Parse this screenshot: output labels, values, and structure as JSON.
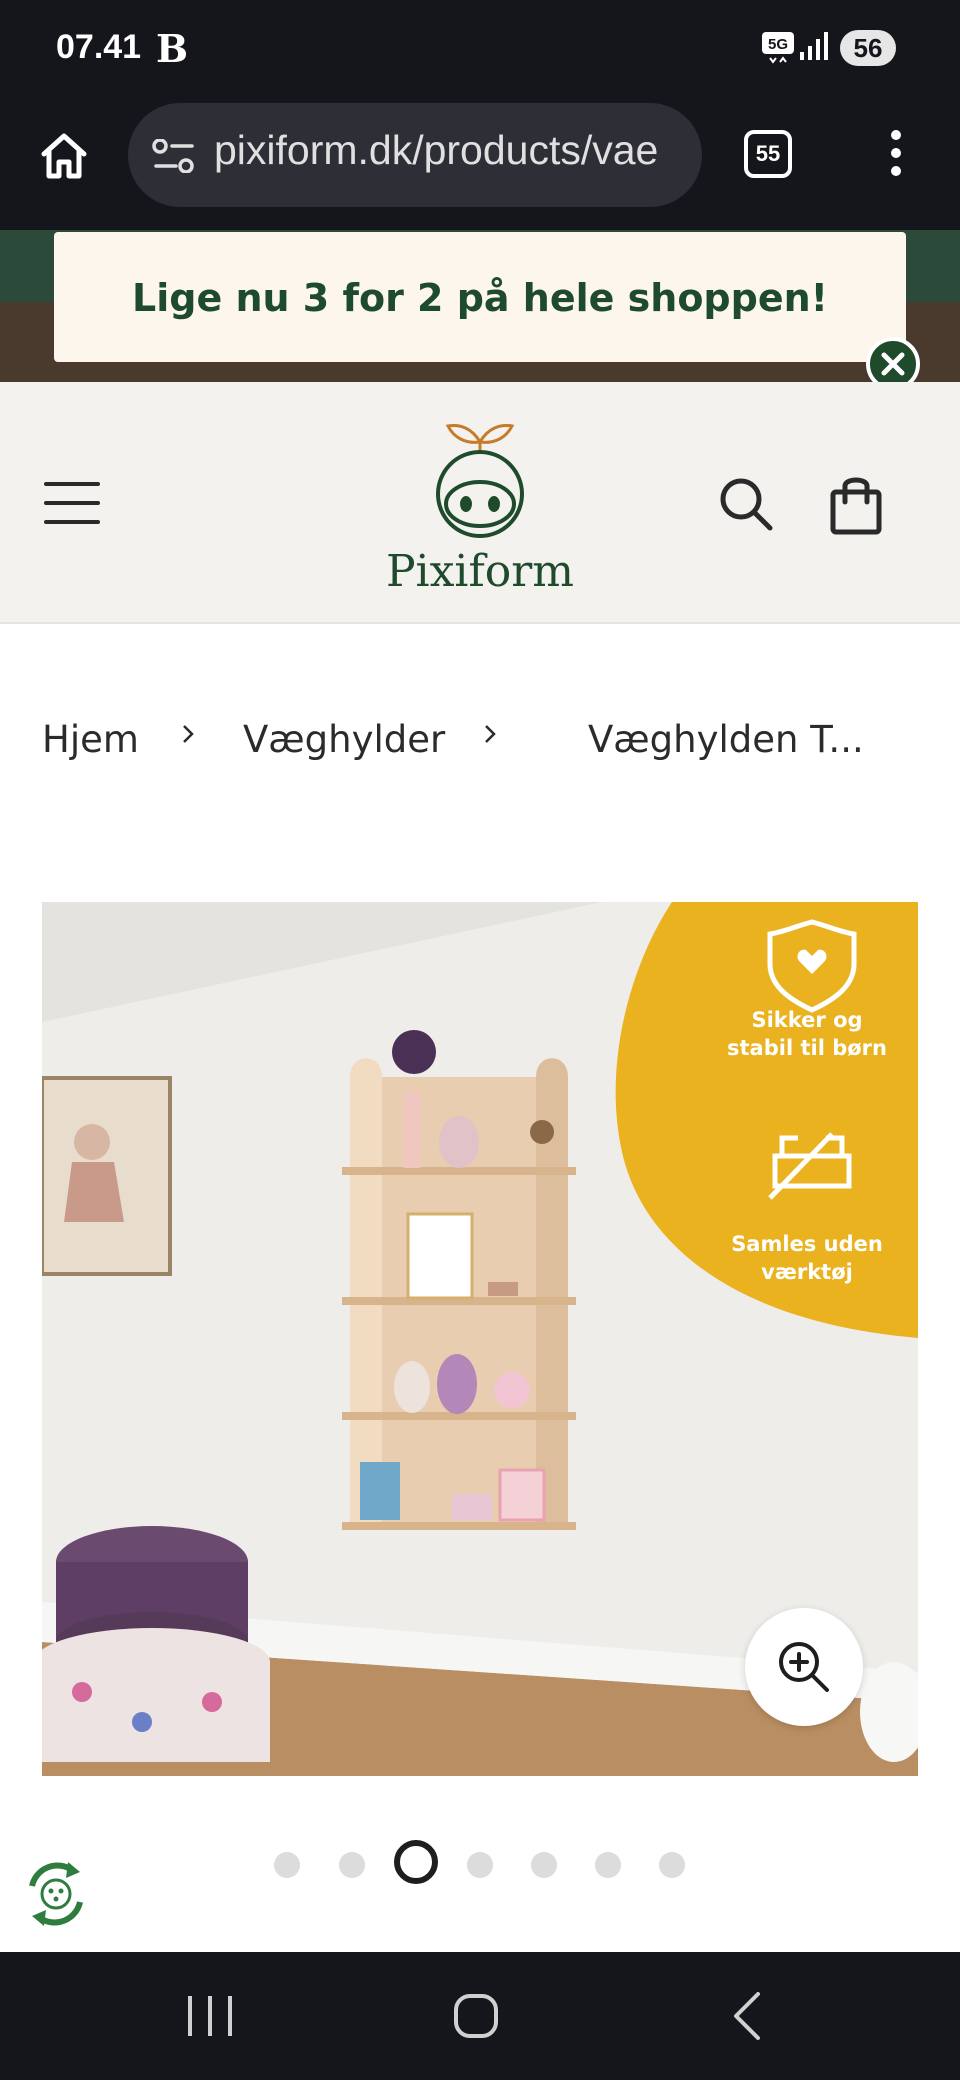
{
  "status_bar": {
    "time": "07.41",
    "app_indicator": "B",
    "network": "5G",
    "battery": "56"
  },
  "browser": {
    "url": "pixiform.dk/products/vae",
    "tab_count": "55"
  },
  "promo": {
    "text": "Lige nu 3 for 2 på hele shoppen!"
  },
  "header": {
    "brand": "Pixiform"
  },
  "breadcrumb": {
    "items": [
      "Hjem",
      "Væghylder",
      "Væghylden T..."
    ]
  },
  "product_image": {
    "badge_1": [
      "Sikker og",
      "stabil til børn"
    ],
    "badge_2": [
      "Samles uden",
      "værktøj"
    ]
  },
  "carousel": {
    "total": 7,
    "active_index": 2
  },
  "colors": {
    "brand_green": "#1f4a2c",
    "badge_yellow": "#e9b21e",
    "popup_bg": "#fdf6ec",
    "header_bg": "#f3f2ee"
  }
}
